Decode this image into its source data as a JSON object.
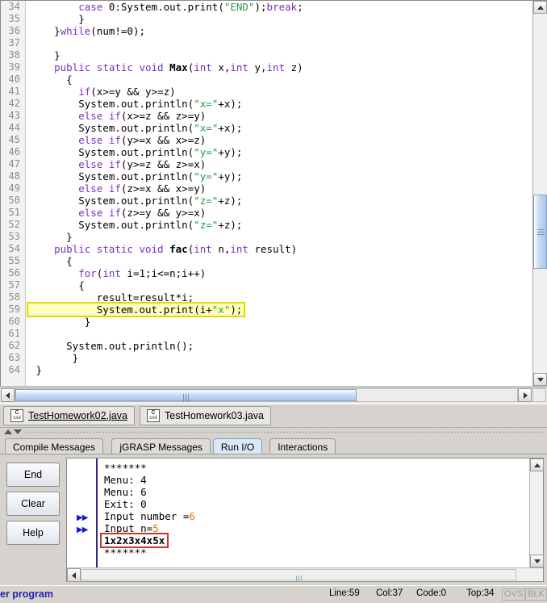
{
  "editor": {
    "first_visible_line": 34,
    "lines": [
      {
        "n": 34,
        "segments": [
          {
            "t": "        ",
            "c": "plain"
          },
          {
            "t": "case",
            "c": "kw"
          },
          {
            "t": " 0:System.out.print(",
            "c": "plain"
          },
          {
            "t": "\"END\"",
            "c": "str"
          },
          {
            "t": ");",
            "c": "plain"
          },
          {
            "t": "break",
            "c": "kw"
          },
          {
            "t": ";",
            "c": "plain"
          }
        ]
      },
      {
        "n": 35,
        "segments": [
          {
            "t": "        }",
            "c": "plain"
          }
        ]
      },
      {
        "n": 36,
        "segments": [
          {
            "t": "    }",
            "c": "plain"
          },
          {
            "t": "while",
            "c": "kw"
          },
          {
            "t": "(num!=0);",
            "c": "plain"
          }
        ]
      },
      {
        "n": 37,
        "segments": [
          {
            "t": "",
            "c": "plain"
          }
        ]
      },
      {
        "n": 38,
        "segments": [
          {
            "t": "    }",
            "c": "plain"
          }
        ]
      },
      {
        "n": 39,
        "segments": [
          {
            "t": "    ",
            "c": "plain"
          },
          {
            "t": "public static void",
            "c": "kw"
          },
          {
            "t": " ",
            "c": "plain"
          },
          {
            "t": "Max",
            "c": "mth"
          },
          {
            "t": "(",
            "c": "plain"
          },
          {
            "t": "int",
            "c": "kw"
          },
          {
            "t": " x,",
            "c": "plain"
          },
          {
            "t": "int",
            "c": "kw"
          },
          {
            "t": " y,",
            "c": "plain"
          },
          {
            "t": "int",
            "c": "kw"
          },
          {
            "t": " z)",
            "c": "plain"
          }
        ]
      },
      {
        "n": 40,
        "segments": [
          {
            "t": "      {",
            "c": "plain"
          }
        ]
      },
      {
        "n": 41,
        "segments": [
          {
            "t": "        ",
            "c": "plain"
          },
          {
            "t": "if",
            "c": "kw"
          },
          {
            "t": "(x>=y && y>=z)",
            "c": "plain"
          }
        ]
      },
      {
        "n": 42,
        "segments": [
          {
            "t": "        System.out.println(",
            "c": "plain"
          },
          {
            "t": "\"x=\"",
            "c": "str"
          },
          {
            "t": "+x);",
            "c": "plain"
          }
        ]
      },
      {
        "n": 43,
        "segments": [
          {
            "t": "        ",
            "c": "plain"
          },
          {
            "t": "else if",
            "c": "kw"
          },
          {
            "t": "(x>=z && z>=y)",
            "c": "plain"
          }
        ]
      },
      {
        "n": 44,
        "segments": [
          {
            "t": "        System.out.println(",
            "c": "plain"
          },
          {
            "t": "\"x=\"",
            "c": "str"
          },
          {
            "t": "+x);",
            "c": "plain"
          }
        ]
      },
      {
        "n": 45,
        "segments": [
          {
            "t": "        ",
            "c": "plain"
          },
          {
            "t": "else if",
            "c": "kw"
          },
          {
            "t": "(y>=x && x>=z)",
            "c": "plain"
          }
        ]
      },
      {
        "n": 46,
        "segments": [
          {
            "t": "        System.out.println(",
            "c": "plain"
          },
          {
            "t": "\"y=\"",
            "c": "str"
          },
          {
            "t": "+y);",
            "c": "plain"
          }
        ]
      },
      {
        "n": 47,
        "segments": [
          {
            "t": "        ",
            "c": "plain"
          },
          {
            "t": "else if",
            "c": "kw"
          },
          {
            "t": "(y>=z && z>=x)",
            "c": "plain"
          }
        ]
      },
      {
        "n": 48,
        "segments": [
          {
            "t": "        System.out.println(",
            "c": "plain"
          },
          {
            "t": "\"y=\"",
            "c": "str"
          },
          {
            "t": "+y);",
            "c": "plain"
          }
        ]
      },
      {
        "n": 49,
        "segments": [
          {
            "t": "        ",
            "c": "plain"
          },
          {
            "t": "else if",
            "c": "kw"
          },
          {
            "t": "(z>=x && x>=y)",
            "c": "plain"
          }
        ]
      },
      {
        "n": 50,
        "segments": [
          {
            "t": "        System.out.println(",
            "c": "plain"
          },
          {
            "t": "\"z=\"",
            "c": "str"
          },
          {
            "t": "+z);",
            "c": "plain"
          }
        ]
      },
      {
        "n": 51,
        "segments": [
          {
            "t": "        ",
            "c": "plain"
          },
          {
            "t": "else if",
            "c": "kw"
          },
          {
            "t": "(z>=y && y>=x)",
            "c": "plain"
          }
        ]
      },
      {
        "n": 52,
        "segments": [
          {
            "t": "        System.out.println(",
            "c": "plain"
          },
          {
            "t": "\"z=\"",
            "c": "str"
          },
          {
            "t": "+z);",
            "c": "plain"
          }
        ]
      },
      {
        "n": 53,
        "segments": [
          {
            "t": "      }",
            "c": "plain"
          }
        ]
      },
      {
        "n": 54,
        "segments": [
          {
            "t": "    ",
            "c": "plain"
          },
          {
            "t": "public static void",
            "c": "kw"
          },
          {
            "t": " ",
            "c": "plain"
          },
          {
            "t": "fac",
            "c": "mth"
          },
          {
            "t": "(",
            "c": "plain"
          },
          {
            "t": "int",
            "c": "kw"
          },
          {
            "t": " n,",
            "c": "plain"
          },
          {
            "t": "int",
            "c": "kw"
          },
          {
            "t": " result)",
            "c": "plain"
          }
        ]
      },
      {
        "n": 55,
        "segments": [
          {
            "t": "      {",
            "c": "plain"
          }
        ]
      },
      {
        "n": 56,
        "segments": [
          {
            "t": "        ",
            "c": "plain"
          },
          {
            "t": "for",
            "c": "kw"
          },
          {
            "t": "(",
            "c": "plain"
          },
          {
            "t": "int",
            "c": "kw"
          },
          {
            "t": " i=1;i<=n;i++)",
            "c": "plain"
          }
        ]
      },
      {
        "n": 57,
        "segments": [
          {
            "t": "        {",
            "c": "plain"
          }
        ]
      },
      {
        "n": 58,
        "segments": [
          {
            "t": "           result=result*i;",
            "c": "plain"
          }
        ]
      },
      {
        "n": 59,
        "highlight": true,
        "segments": [
          {
            "t": "           System.out.print(i+",
            "c": "plain"
          },
          {
            "t": "\"x\"",
            "c": "str"
          },
          {
            "t": ");",
            "c": "plain"
          }
        ]
      },
      {
        "n": 60,
        "segments": [
          {
            "t": "         }",
            "c": "plain"
          }
        ]
      },
      {
        "n": 61,
        "segments": [
          {
            "t": "",
            "c": "plain"
          }
        ]
      },
      {
        "n": 62,
        "segments": [
          {
            "t": "      System.out.println();",
            "c": "plain"
          }
        ]
      },
      {
        "n": 63,
        "segments": [
          {
            "t": "       }",
            "c": "plain"
          }
        ]
      },
      {
        "n": 64,
        "segments": [
          {
            "t": " }",
            "c": "plain"
          }
        ]
      }
    ]
  },
  "file_tabs": [
    {
      "label": "TestHomework02.java",
      "icon": "csd-file-icon",
      "active": true
    },
    {
      "label": "TestHomework03.java",
      "icon": "csd-file-icon",
      "active": false
    }
  ],
  "panel_tabs": [
    {
      "label": "Compile Messages",
      "active": false
    },
    {
      "label": "jGRASP Messages",
      "active": false
    },
    {
      "label": "Run I/O",
      "active": true
    },
    {
      "label": "Interactions",
      "active": false
    }
  ],
  "io_panel": {
    "buttons": [
      {
        "label": "End",
        "name": "end-button"
      },
      {
        "label": "Clear",
        "name": "clear-button"
      },
      {
        "label": "Help",
        "name": "help-button"
      }
    ],
    "console_lines": [
      {
        "text": "*******",
        "marker": false
      },
      {
        "text": "Menu: 4",
        "marker": false
      },
      {
        "text": "Menu: 6",
        "marker": false
      },
      {
        "text": "Exit: 0",
        "marker": false
      },
      {
        "text": "Input number =",
        "input": "6",
        "marker": true
      },
      {
        "text": "Input n=",
        "input": "5",
        "marker": true
      },
      {
        "text": "1x2x3x4x5x",
        "marker": false,
        "highlight": true
      },
      {
        "text": "*******",
        "marker": false
      }
    ],
    "marker_glyph": "▶▶"
  },
  "status_bar": {
    "message": "er program",
    "line": "Line:59",
    "col": "Col:37",
    "code": "Code:0",
    "top": "Top:34",
    "ovs": "OVS",
    "blk": "BLK"
  },
  "colors": {
    "keyword": "#7b2fbe",
    "string": "#2a9a4a",
    "highlight_code": "#e8d400",
    "highlight_output": "#c0392b",
    "input_value": "#d07818",
    "marker": "#1818d0",
    "status_message": "#2222aa"
  }
}
